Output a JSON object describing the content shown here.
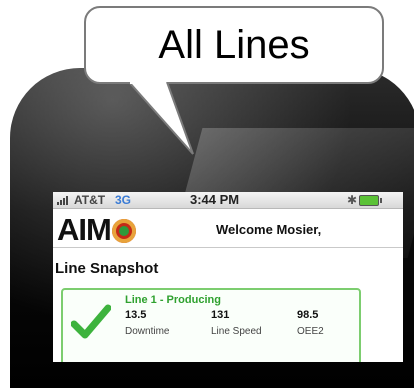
{
  "bubble": {
    "text": "All Lines"
  },
  "status_bar": {
    "carrier": "AT&T",
    "network": "3G",
    "time": "3:44 PM",
    "bluetooth_icon": "bluetooth-icon",
    "battery_icon": "battery-icon"
  },
  "header": {
    "logo_text": "AIM",
    "welcome": "Welcome Mosier,"
  },
  "section": {
    "title": "Line Snapshot"
  },
  "lines": [
    {
      "title": "Line 1 - Producing",
      "status_icon": "check-icon",
      "metrics": [
        {
          "value": "13.5",
          "label": "Downtime"
        },
        {
          "value": "131",
          "label": "Line Speed"
        },
        {
          "value": "98.5",
          "label": "OEE2"
        }
      ]
    }
  ],
  "colors": {
    "accent_green": "#2fa12f",
    "network_blue": "#3a7bd5",
    "logo_red": "#c42a17"
  }
}
